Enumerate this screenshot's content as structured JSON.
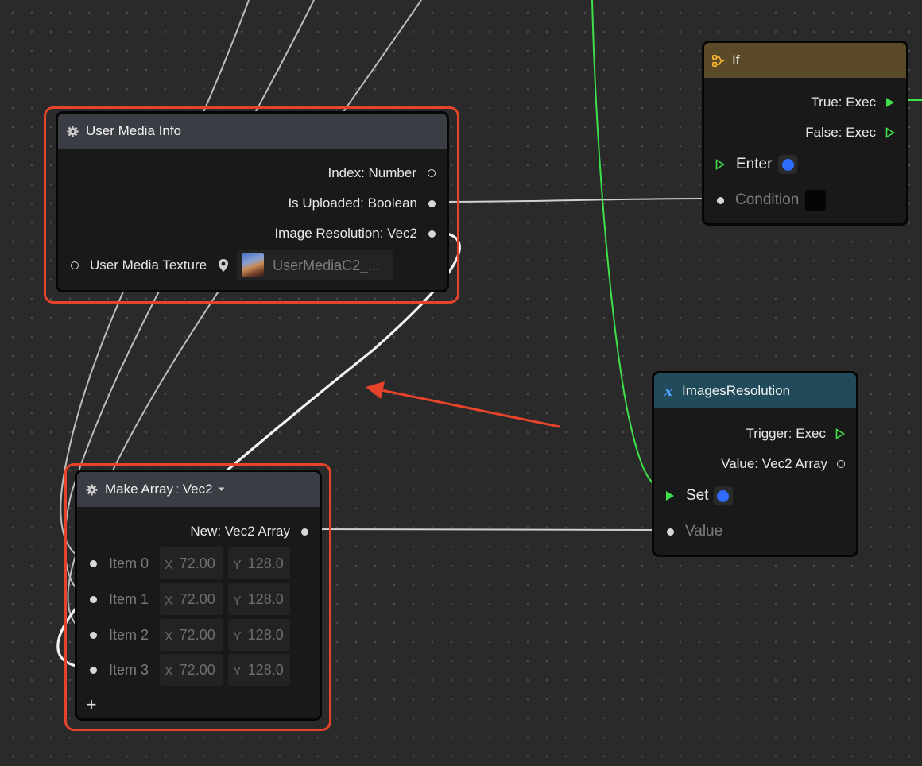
{
  "colors": {
    "canvas": "#2a2a2a",
    "highlight": "#e5432a",
    "exec_green": "#3ee04a",
    "pin_blue": "#2f6bff"
  },
  "nodes": {
    "user_media_info": {
      "title": "User Media Info",
      "icon": "gear-icon",
      "outputs": [
        "Index: Number",
        "Is Uploaded: Boolean",
        "Image Resolution: Vec2"
      ],
      "input_label": "User Media Texture",
      "texture_value": "UserMediaC2_..."
    },
    "if_node": {
      "title": "If",
      "icon": "branch-icon",
      "outputs": [
        "True: Exec",
        "False: Exec"
      ],
      "inputs": [
        "Enter",
        "Condition"
      ]
    },
    "images_resolution": {
      "title": "ImagesResolution",
      "icon": "variable-x-icon",
      "outputs": [
        "Trigger: Exec",
        "Value: Vec2 Array"
      ],
      "inputs": [
        "Set",
        "Value"
      ]
    },
    "make_array": {
      "title": "Make Array",
      "type_value": "Vec2",
      "icon": "gear-icon",
      "output": "New: Vec2 Array",
      "items": [
        {
          "label": "Item 0",
          "x": "72.00",
          "y": "128.0"
        },
        {
          "label": "Item 1",
          "x": "72.00",
          "y": "128.0"
        },
        {
          "label": "Item 2",
          "x": "72.00",
          "y": "128.0"
        },
        {
          "label": "Item 3",
          "x": "72.00",
          "y": "128.0"
        }
      ],
      "axis_x": "X",
      "axis_y": "Y",
      "add_label": "+"
    }
  }
}
